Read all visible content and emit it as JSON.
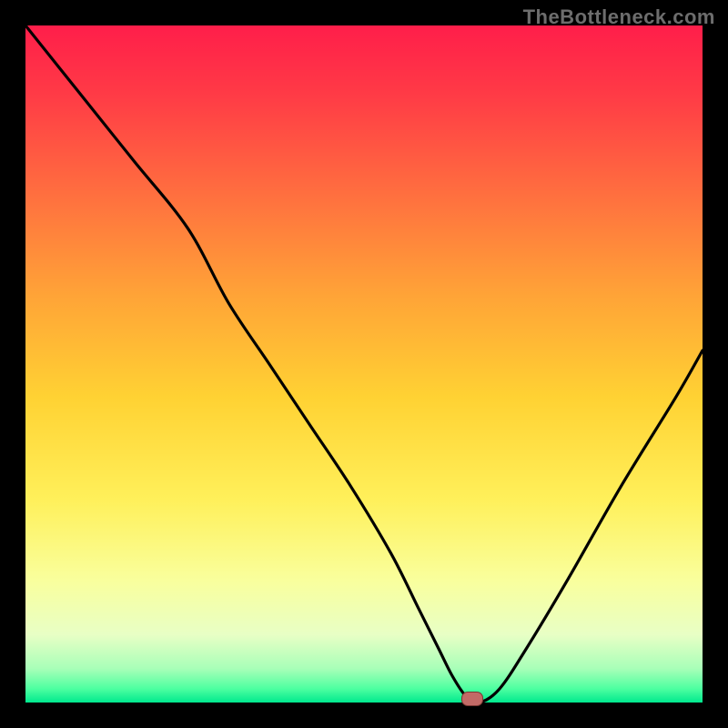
{
  "watermark": {
    "text": "TheBottleneck.com"
  },
  "chart_data": {
    "type": "line",
    "title": "",
    "xlabel": "",
    "ylabel": "",
    "xlim": [
      0,
      100
    ],
    "ylim": [
      0,
      100
    ],
    "grid": false,
    "legend": null,
    "series": [
      {
        "name": "bottleneck-curve",
        "x": [
          0,
          8,
          16,
          24,
          30,
          36,
          42,
          48,
          54,
          58,
          61,
          63,
          65,
          67,
          70,
          74,
          80,
          88,
          96,
          100
        ],
        "y": [
          100,
          90,
          80,
          70,
          59,
          50,
          41,
          32,
          22,
          14,
          8,
          4,
          1,
          0,
          2,
          8,
          18,
          32,
          45,
          52
        ]
      }
    ],
    "marker": {
      "x": 66,
      "y": 0.5
    },
    "background_gradient": {
      "stops": [
        {
          "pos": 0.0,
          "color": "#ff1e4a"
        },
        {
          "pos": 0.1,
          "color": "#ff3a46"
        },
        {
          "pos": 0.25,
          "color": "#ff6f3f"
        },
        {
          "pos": 0.4,
          "color": "#ffa437"
        },
        {
          "pos": 0.55,
          "color": "#ffd233"
        },
        {
          "pos": 0.7,
          "color": "#fff05a"
        },
        {
          "pos": 0.82,
          "color": "#f9ff9d"
        },
        {
          "pos": 0.9,
          "color": "#e8ffc5"
        },
        {
          "pos": 0.95,
          "color": "#a8ffb8"
        },
        {
          "pos": 0.98,
          "color": "#4cffa0"
        },
        {
          "pos": 1.0,
          "color": "#00e98e"
        }
      ]
    }
  }
}
